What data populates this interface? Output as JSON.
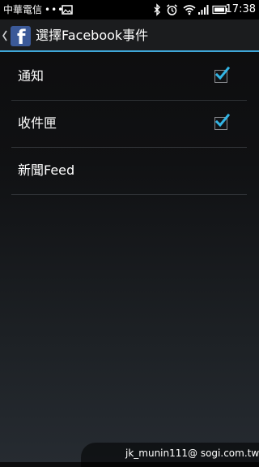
{
  "status_bar": {
    "carrier": "中華電信",
    "overflow_dots": "•••",
    "icons": [
      "image-icon",
      "bluetooth-icon",
      "alarm-icon",
      "wifi-icon",
      "signal-icon",
      "battery-icon"
    ],
    "time": "17:38"
  },
  "action_bar": {
    "app_icon": "facebook-icon",
    "app_icon_glyph": "f",
    "title": "選擇Facebook事件",
    "accent_color": "#3fa7d8"
  },
  "list": {
    "items": [
      {
        "label": "通知",
        "checked": true
      },
      {
        "label": "收件匣",
        "checked": true
      },
      {
        "label": "新聞Feed",
        "checked": false
      }
    ],
    "check_color": "#33b5e5"
  },
  "watermark": {
    "text": "jk_munin111@ sogi.com.tw"
  }
}
